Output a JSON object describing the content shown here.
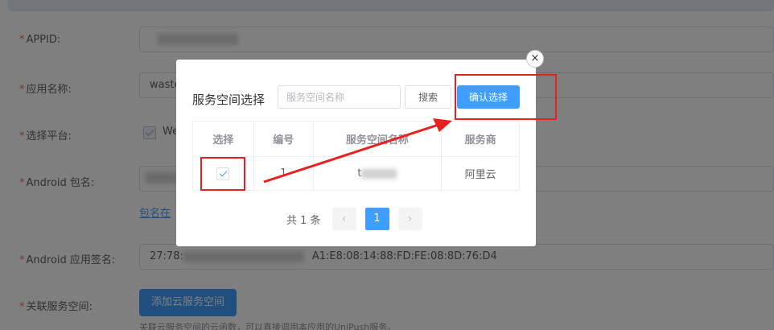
{
  "form": {
    "appid_label": "APPID:",
    "appid_value": "",
    "appname_label": "应用名称:",
    "appname_value": "waste",
    "platform_label": "选择平台:",
    "platform_option": "We",
    "android_pkg_label": "Android 包名:",
    "android_pkg_link": "包名在",
    "android_sign_label": "Android 应用签名:",
    "android_sign_value_prefix": "27:78:",
    "android_sign_value_suffix": "A1:E8:08:14:88:FD:FE:08:8D:76:D4",
    "service_space_label": "关联服务空间:",
    "add_space_button": "添加云服务空间",
    "hint": "关联云服务空间的云函数，可以直接调用本应用的UniPush服务。",
    "required_mark": "*"
  },
  "dialog": {
    "title": "服务空间选择",
    "search_placeholder": "服务空间名称",
    "search_button": "搜索",
    "confirm_button": "确认选择",
    "close_glyph": "×",
    "table": {
      "headers": [
        "选择",
        "编号",
        "服务空间名称",
        "服务商"
      ],
      "rows": [
        {
          "selected": true,
          "id": "1",
          "name": "t",
          "provider": "阿里云"
        }
      ]
    },
    "pagination": {
      "total_text": "共 1 条",
      "prev_glyph": "‹",
      "next_glyph": "›",
      "current_page": "1"
    }
  },
  "colors": {
    "primary": "#409eff",
    "annotation": "#e8201f",
    "required": "#f56c6c"
  },
  "icons": {
    "close": "close-icon",
    "check": "check-icon",
    "prev": "chevron-left-icon",
    "next": "chevron-right-icon",
    "annotation_arrow": "arrow-annotation"
  }
}
